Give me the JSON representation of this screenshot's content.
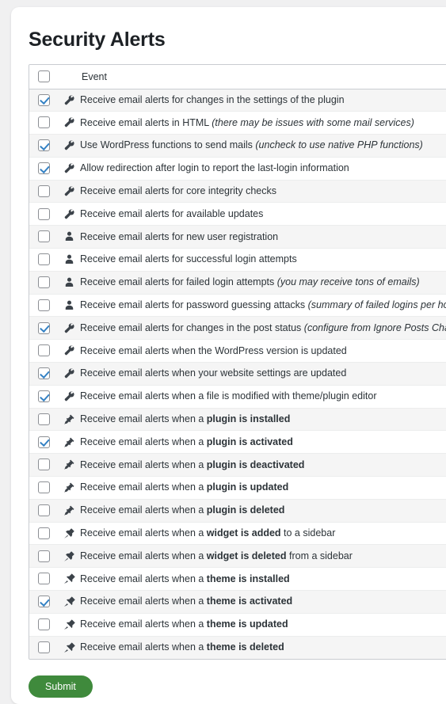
{
  "page": {
    "title": "Security Alerts",
    "accent_color": "#3f8a3c",
    "checkbox_check_color": "#3582c4",
    "stripe_color": "#f5f5f5",
    "card_background": "#ffffff",
    "page_background": "#f0f0f1"
  },
  "table": {
    "header": {
      "select_all_checked": false,
      "event_column_label": "Event"
    },
    "rows": [
      {
        "checked": true,
        "icon": "wrench-icon",
        "text": "Receive email alerts for changes in the settings of the plugin",
        "bold": "",
        "tail": "",
        "note": ""
      },
      {
        "checked": false,
        "icon": "wrench-icon",
        "text": "Receive email alerts in HTML ",
        "bold": "",
        "tail": "",
        "note": "(there may be issues with some mail services)"
      },
      {
        "checked": true,
        "icon": "wrench-icon",
        "text": "Use WordPress functions to send mails ",
        "bold": "",
        "tail": "",
        "note": "(uncheck to use native PHP functions)"
      },
      {
        "checked": true,
        "icon": "wrench-icon",
        "text": "Allow redirection after login to report the last-login information",
        "bold": "",
        "tail": "",
        "note": ""
      },
      {
        "checked": false,
        "icon": "wrench-icon",
        "text": "Receive email alerts for core integrity checks",
        "bold": "",
        "tail": "",
        "note": ""
      },
      {
        "checked": false,
        "icon": "wrench-icon",
        "text": "Receive email alerts for available updates",
        "bold": "",
        "tail": "",
        "note": ""
      },
      {
        "checked": false,
        "icon": "user-icon",
        "text": "Receive email alerts for new user registration",
        "bold": "",
        "tail": "",
        "note": ""
      },
      {
        "checked": false,
        "icon": "user-icon",
        "text": "Receive email alerts for successful login attempts",
        "bold": "",
        "tail": "",
        "note": ""
      },
      {
        "checked": false,
        "icon": "user-icon",
        "text": "Receive email alerts for failed login attempts ",
        "bold": "",
        "tail": "",
        "note": "(you may receive tons of emails)"
      },
      {
        "checked": false,
        "icon": "user-icon",
        "text": "Receive email alerts for password guessing attacks ",
        "bold": "",
        "tail": "",
        "note": "(summary of failed logins per hour)"
      },
      {
        "checked": true,
        "icon": "wrench-icon",
        "text": "Receive email alerts for changes in the post status ",
        "bold": "",
        "tail": "",
        "note": "(configure from Ignore Posts Changes)"
      },
      {
        "checked": false,
        "icon": "wrench-icon",
        "text": "Receive email alerts when the WordPress version is updated",
        "bold": "",
        "tail": "",
        "note": ""
      },
      {
        "checked": true,
        "icon": "wrench-icon",
        "text": "Receive email alerts when your website settings are updated",
        "bold": "",
        "tail": "",
        "note": ""
      },
      {
        "checked": true,
        "icon": "wrench-icon",
        "text": "Receive email alerts when a file is modified with theme/plugin editor",
        "bold": "",
        "tail": "",
        "note": ""
      },
      {
        "checked": false,
        "icon": "plug-icon",
        "text": "Receive email alerts when a ",
        "bold": "plugin is installed",
        "tail": "",
        "note": ""
      },
      {
        "checked": true,
        "icon": "plug-icon",
        "text": "Receive email alerts when a ",
        "bold": "plugin is activated",
        "tail": "",
        "note": ""
      },
      {
        "checked": false,
        "icon": "plug-icon",
        "text": "Receive email alerts when a ",
        "bold": "plugin is deactivated",
        "tail": "",
        "note": ""
      },
      {
        "checked": false,
        "icon": "plug-icon",
        "text": "Receive email alerts when a ",
        "bold": "plugin is updated",
        "tail": "",
        "note": ""
      },
      {
        "checked": false,
        "icon": "plug-icon",
        "text": "Receive email alerts when a ",
        "bold": "plugin is deleted",
        "tail": "",
        "note": ""
      },
      {
        "checked": false,
        "icon": "pushpin-icon",
        "text": "Receive email alerts when a ",
        "bold": "widget is added",
        "tail": " to a sidebar",
        "note": ""
      },
      {
        "checked": false,
        "icon": "pushpin-icon",
        "text": "Receive email alerts when a ",
        "bold": "widget is deleted",
        "tail": " from a sidebar",
        "note": ""
      },
      {
        "checked": false,
        "icon": "paintbrush-icon",
        "text": "Receive email alerts when a ",
        "bold": "theme is installed",
        "tail": "",
        "note": ""
      },
      {
        "checked": true,
        "icon": "paintbrush-icon",
        "text": "Receive email alerts when a ",
        "bold": "theme is activated",
        "tail": "",
        "note": ""
      },
      {
        "checked": false,
        "icon": "paintbrush-icon",
        "text": "Receive email alerts when a ",
        "bold": "theme is updated",
        "tail": "",
        "note": ""
      },
      {
        "checked": false,
        "icon": "paintbrush-icon",
        "text": "Receive email alerts when a ",
        "bold": "theme is deleted",
        "tail": "",
        "note": ""
      }
    ]
  },
  "footer": {
    "submit_label": "Submit"
  }
}
